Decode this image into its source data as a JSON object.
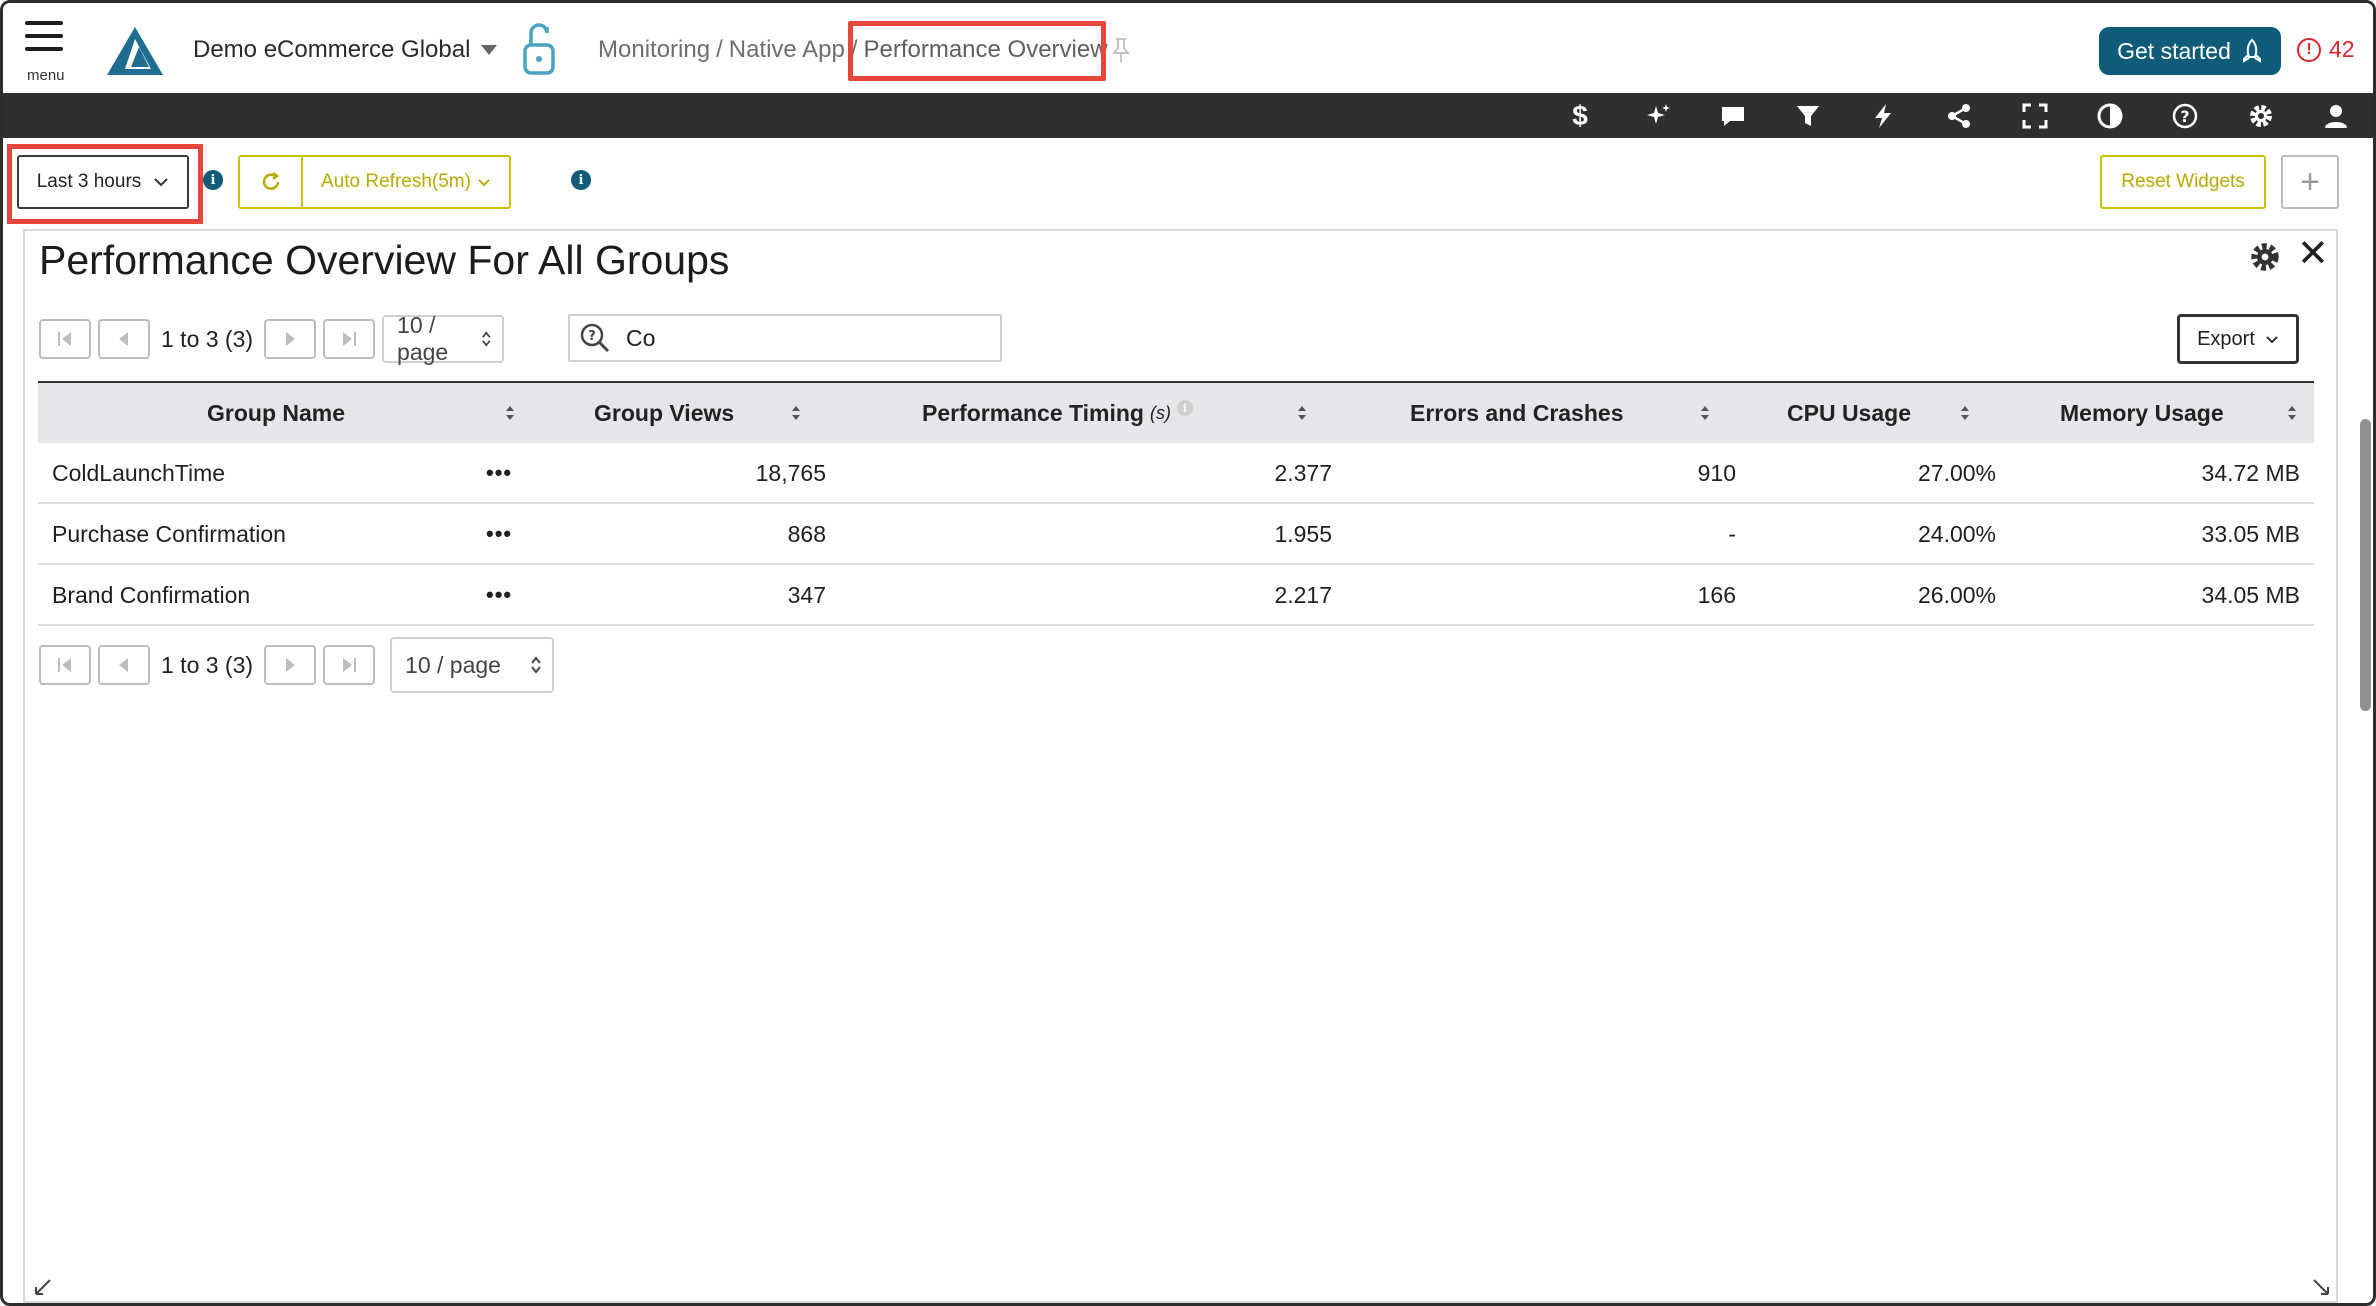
{
  "header": {
    "menu_label": "menu",
    "org_name": "Demo eCommerce Global",
    "breadcrumb": [
      "Monitoring",
      "Native App",
      "Performance Overview"
    ],
    "get_started_label": "Get started",
    "alert_count": "42"
  },
  "toolbar": {
    "icons": [
      "dollar-icon",
      "sparkle-icon",
      "comment-icon",
      "filter-icon",
      "lightning-icon",
      "share-icon",
      "fullscreen-icon",
      "contrast-icon",
      "help-icon",
      "settings-icon",
      "user-icon"
    ]
  },
  "filters": {
    "time_range": "Last 3 hours",
    "auto_refresh_label": "Auto Refresh(5m)",
    "reset_widgets_label": "Reset Widgets",
    "add_widget_label": "+"
  },
  "widget": {
    "title": "Performance Overview For All Groups",
    "pager_text": "1 to 3 (3)",
    "per_page": "10 / page",
    "search_value": "Co",
    "export_label": "Export",
    "columns": [
      "Group Name",
      "Group Views",
      "Performance Timing",
      "Errors and Crashes",
      "CPU Usage",
      "Memory Usage"
    ],
    "timing_unit": "(s)",
    "rows": [
      {
        "name": "ColdLaunchTime",
        "views": "18,765",
        "timing": "2.377",
        "errors": "910",
        "cpu": "27.00%",
        "memory": "34.72 MB"
      },
      {
        "name": "Purchase Confirmation",
        "views": "868",
        "timing": "1.955",
        "errors": "-",
        "cpu": "24.00%",
        "memory": "33.05 MB"
      },
      {
        "name": "Brand Confirmation",
        "views": "347",
        "timing": "2.217",
        "errors": "166",
        "cpu": "26.00%",
        "memory": "34.05 MB"
      }
    ],
    "row_menu": "•••"
  },
  "colors": {
    "brand": "#0f5b7a",
    "highlight": "#e8453c",
    "accent_yellow": "#cfc100",
    "alert": "#d9262c"
  }
}
